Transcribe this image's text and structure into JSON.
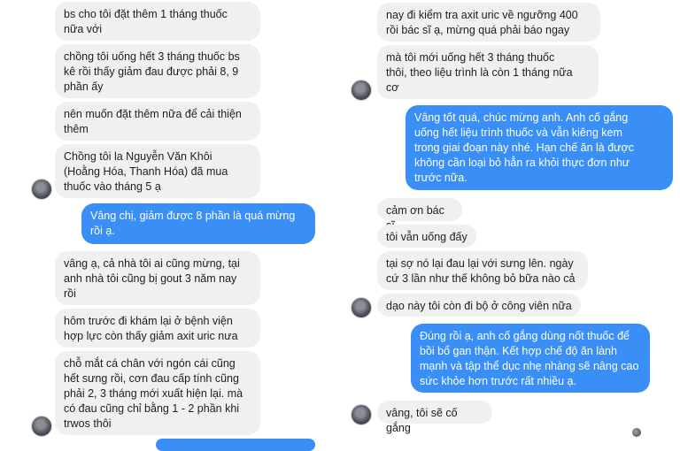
{
  "left_thread": {
    "messages": [
      {
        "side": "in",
        "text": "bs cho tôi đặt thêm 1 tháng thuốc\nnữa với"
      },
      {
        "side": "in",
        "text": "chồng tôi uống hết 3 tháng thuốc bs\nkê rồi thấy giảm đau được phải 8, 9\nphần ấy"
      },
      {
        "side": "in",
        "text": "nên muốn đặt thêm nữa để cải thiện\nthêm"
      },
      {
        "side": "in",
        "text": "Chồng tôi la Nguyễn Văn Khôi\n(Hoằng Hóa, Thanh Hóa) đã mua\nthuốc vào tháng 5 ạ"
      },
      {
        "side": "out",
        "text": "Vâng chị, giảm được 8 phần là quá mừng\nrồi ạ."
      },
      {
        "side": "in",
        "text": "vâng ạ, cả nhà tôi ai cũng mừng, tại\nanh nhà tôi cũng bị gout 3 năm nay\nrồi"
      },
      {
        "side": "in",
        "text": "hôm trước đi khám lại ở bệnh viện\nhợp lực còn thấy giảm axit uric nưa"
      },
      {
        "side": "in",
        "text": "chỗ mắt cá chân với ngón cái cũng\nhết sưng rồi, cơn đau cấp tính cũng\nphải 2, 3 tháng mới xuất hiện lại. mà\ncó đau cũng chỉ bằng 1 - 2 phần khi\ntrwos thôi"
      }
    ]
  },
  "right_thread": {
    "messages": [
      {
        "side": "in",
        "text": "nay đi kiểm tra axit uric về ngưỡng 400\nrồi bác sĩ ạ, mừng quá phải báo ngay"
      },
      {
        "side": "in",
        "text": "mà tôi mới uống hết 3 tháng thuốc\nthôi, theo liệu trình là còn 1 tháng nữa\ncơ"
      },
      {
        "side": "out",
        "text": "Vâng tốt quá, chúc mừng anh. Anh cố gắng\nuống hết liệu trình thuốc và vẫn kiêng kem\ntrong giai đoạn này nhé. Hạn chế ăn là được\nkhông cần loại bỏ hẳn ra khỏi thực đơn như\ntrước nữa."
      },
      {
        "side": "in",
        "text": "cảm ơn bác sĩ"
      },
      {
        "side": "in",
        "text": "tôi vẫn uống đấy"
      },
      {
        "side": "in",
        "text": "tại sợ nó lại đau lại với sưng lên. ngày\ncứ 3 lần như thế không bỏ bữa nào cả"
      },
      {
        "side": "in",
        "text": "dạo này tôi còn đi bộ ở công viên nữa"
      },
      {
        "side": "out",
        "text": "Đúng rồi ạ, anh cố gắng dùng nốt thuốc để\nbồi bổ gan thận. Kết hợp chế độ ăn lành\nmạnh và tập thể dục nhẹ nhàng sẽ nâng cao\nsức khỏe hơn trước rất nhiều ạ."
      },
      {
        "side": "in",
        "text": "vâng, tôi sẽ cố gắng"
      }
    ]
  },
  "colors": {
    "incoming_bubble": "#f0f0f0",
    "outgoing_bubble": "#3a8ff7",
    "outgoing_text": "#ffffff"
  }
}
